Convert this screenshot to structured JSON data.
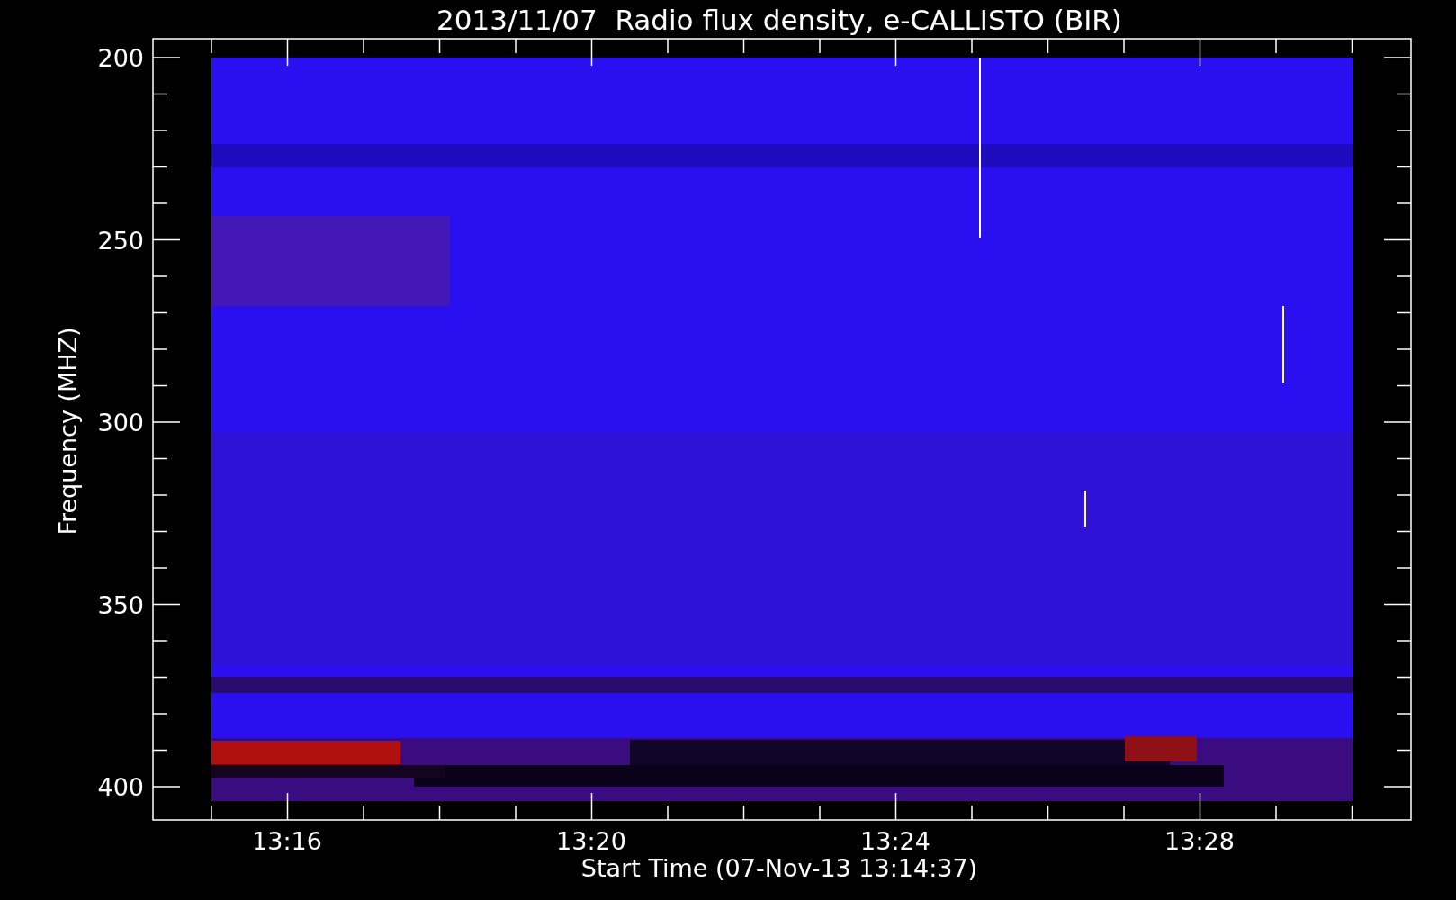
{
  "chart": {
    "title": "2013/11/07  Radio flux density, e-CALLISTO (BIR)",
    "ylabel": "Frequency (MHZ)",
    "xlabel": "Start Time (07-Nov-13 13:14:37)",
    "yticks": [
      "200",
      "250",
      "300",
      "350",
      "400"
    ],
    "xticks": [
      "13:16",
      "13:20",
      "13:24",
      "13:28"
    ]
  }
}
